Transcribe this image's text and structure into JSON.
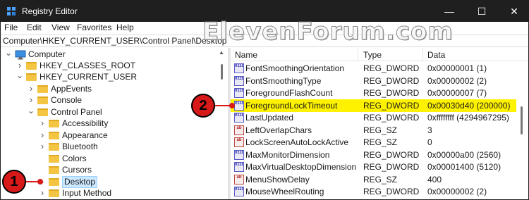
{
  "window": {
    "title": "Registry Editor",
    "controls": {
      "minimize": "—",
      "maximize": "☐",
      "close": "✕"
    }
  },
  "menu": [
    "File",
    "Edit",
    "View",
    "Favorites",
    "Help"
  ],
  "address": "Computer\\HKEY_CURRENT_USER\\Control Panel\\Desktop",
  "watermark": "ElevenForum.com",
  "tree": [
    {
      "label": "Computer",
      "icon": "computer-icon",
      "expander": "chevron-down-icon"
    },
    {
      "label": "HKEY_CLASSES_ROOT",
      "icon": "folder-icon",
      "expander": "chevron-right-icon"
    },
    {
      "label": "HKEY_CURRENT_USER",
      "icon": "folder-icon",
      "expander": "chevron-down-icon"
    },
    {
      "label": "AppEvents",
      "icon": "folder-icon",
      "expander": "chevron-right-icon"
    },
    {
      "label": "Console",
      "icon": "folder-icon",
      "expander": "chevron-right-icon"
    },
    {
      "label": "Control Panel",
      "icon": "folder-icon",
      "expander": "chevron-down-icon"
    },
    {
      "label": "Accessibility",
      "icon": "folder-icon",
      "expander": "chevron-right-icon"
    },
    {
      "label": "Appearance",
      "icon": "folder-icon",
      "expander": "chevron-right-icon"
    },
    {
      "label": "Bluetooth",
      "icon": "folder-icon",
      "expander": "chevron-right-icon"
    },
    {
      "label": "Colors",
      "icon": "folder-icon",
      "expander": ""
    },
    {
      "label": "Cursors",
      "icon": "folder-icon",
      "expander": ""
    },
    {
      "label": "Desktop",
      "icon": "folder-icon",
      "expander": "chevron-right-icon",
      "selected": true
    },
    {
      "label": "Input Method",
      "icon": "folder-icon",
      "expander": "chevron-right-icon"
    }
  ],
  "list": {
    "columns": [
      "Name",
      "Type",
      "Data"
    ],
    "rows": [
      {
        "name": "FontSmoothingOrientation",
        "type": "REG_DWORD",
        "data": "0x00000001 (1)",
        "icon": "reg-dword-icon"
      },
      {
        "name": "FontSmoothingType",
        "type": "REG_DWORD",
        "data": "0x00000002 (2)",
        "icon": "reg-dword-icon"
      },
      {
        "name": "ForegroundFlashCount",
        "type": "REG_DWORD",
        "data": "0x00000007 (7)",
        "icon": "reg-dword-icon"
      },
      {
        "name": "ForegroundLockTimeout",
        "type": "REG_DWORD",
        "data": "0x00030d40 (200000)",
        "icon": "reg-dword-icon",
        "highlight": true
      },
      {
        "name": "LastUpdated",
        "type": "REG_DWORD",
        "data": "0xffffffff (4294967295)",
        "icon": "reg-dword-icon"
      },
      {
        "name": "LeftOverlapChars",
        "type": "REG_SZ",
        "data": "3",
        "icon": "reg-sz-icon"
      },
      {
        "name": "LockScreenAutoLockActive",
        "type": "REG_SZ",
        "data": "0",
        "icon": "reg-sz-icon"
      },
      {
        "name": "MaxMonitorDimension",
        "type": "REG_DWORD",
        "data": "0x00000a00 (2560)",
        "icon": "reg-dword-icon"
      },
      {
        "name": "MaxVirtualDesktopDimension",
        "type": "REG_DWORD",
        "data": "0x00001400 (5120)",
        "icon": "reg-dword-icon"
      },
      {
        "name": "MenuShowDelay",
        "type": "REG_SZ",
        "data": "400",
        "icon": "reg-sz-icon"
      },
      {
        "name": "MouseWheelRouting",
        "type": "REG_DWORD",
        "data": "0x00000002 (2)",
        "icon": "reg-dword-icon"
      }
    ]
  },
  "callouts": {
    "one": "1",
    "two": "2"
  },
  "colors": {
    "titlebar": "#1f1f1f",
    "highlight": "#fff200",
    "callout": "#d81919",
    "selection": "#cce8ff"
  }
}
